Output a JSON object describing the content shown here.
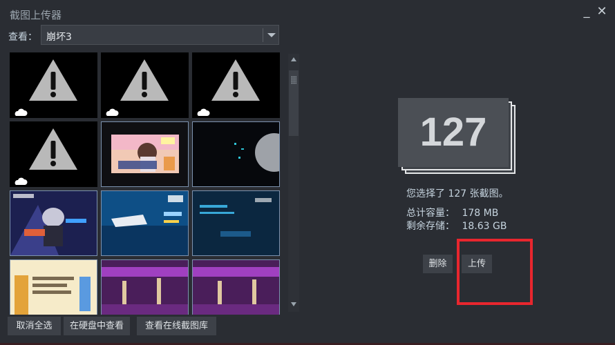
{
  "window": {
    "title": "截图上传器",
    "minimize": "_",
    "close": "✕"
  },
  "filter": {
    "label": "查看：",
    "selected": "崩坏3"
  },
  "thumbnails": [
    {
      "kind": "warning",
      "selected": false,
      "cloud": true
    },
    {
      "kind": "warning",
      "selected": false,
      "cloud": true
    },
    {
      "kind": "warning",
      "selected": false,
      "cloud": true
    },
    {
      "kind": "warning",
      "selected": false,
      "cloud": true
    },
    {
      "kind": "screenshot",
      "selected": true,
      "cloud": false
    },
    {
      "kind": "screenshot",
      "selected": true,
      "cloud": false
    },
    {
      "kind": "screenshot",
      "selected": true,
      "cloud": false
    },
    {
      "kind": "screenshot",
      "selected": true,
      "cloud": false
    },
    {
      "kind": "screenshot",
      "selected": true,
      "cloud": false
    },
    {
      "kind": "screenshot",
      "selected": true,
      "cloud": false
    },
    {
      "kind": "screenshot",
      "selected": true,
      "cloud": false
    },
    {
      "kind": "screenshot",
      "selected": true,
      "cloud": false
    }
  ],
  "bottom_buttons": {
    "deselect_all": "取消全选",
    "view_on_disk": "在硬盘中查看",
    "view_online": "查看在线截图库"
  },
  "summary": {
    "count": "127",
    "selected_text": "您选择了 127 张截图。",
    "total_label": "总计容量：",
    "total_value": "178 MB",
    "remaining_label": "剩余存储：",
    "remaining_value": "18.63 GB"
  },
  "actions": {
    "delete": "删除",
    "upload": "上传"
  },
  "colors": {
    "highlight": "#e8262e",
    "selection_border": "#7d93b0",
    "background": "#2a2d33"
  }
}
